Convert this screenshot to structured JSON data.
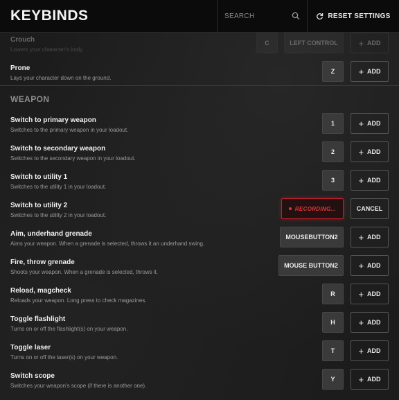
{
  "header": {
    "title": "KEYBINDS",
    "search_placeholder": "SEARCH",
    "reset_label": "RESET SETTINGS"
  },
  "add_label": "ADD",
  "cancel_label": "CANCEL",
  "recording_label": "RECORDING...",
  "top_rows": [
    {
      "name": "Crouch",
      "desc": "Lowers your character's body.",
      "key1": "C",
      "key2": "LEFT CONTROL"
    },
    {
      "name": "Prone",
      "desc": "Lays your character down on the ground.",
      "key1": "Z"
    }
  ],
  "section_title": "WEAPON",
  "weapon_rows": [
    {
      "name": "Switch to primary weapon",
      "desc": "Switches to the primary weapon in your loadout.",
      "key": "1"
    },
    {
      "name": "Switch to secondary weapon",
      "desc": "Switches to the secondary weapon in your loadout.",
      "key": "2"
    },
    {
      "name": "Switch to utility 1",
      "desc": "Switches to the utility 1 in your loadout.",
      "key": "3"
    },
    {
      "name": "Switch to utility 2",
      "desc": "Switches to the utility 2 in your loadout.",
      "key": ""
    },
    {
      "name": "Aim, underhand grenade",
      "desc": "Aims your weapon. When a grenade is selected, throws it an underhand swing.",
      "key": "MOUSEBUTTON2"
    },
    {
      "name": "Fire, throw grenade",
      "desc": "Shoots your weapon. When a grenade is selected, throws it.",
      "key": "MOUSE BUTTON2"
    },
    {
      "name": "Reload, magcheck",
      "desc": "Reloads your weapon. Long press to check magazines.",
      "key": "R"
    },
    {
      "name": "Toggle flashlight",
      "desc": "Turns on or off the flashlight(s) on your weapon.",
      "key": "H"
    },
    {
      "name": "Toggle laser",
      "desc": "Turns on or off the laser(s) on your weapon.",
      "key": "T"
    },
    {
      "name": "Switch scope",
      "desc": "Switches your weapon's scope (if there is another one).",
      "key": "Y"
    }
  ]
}
